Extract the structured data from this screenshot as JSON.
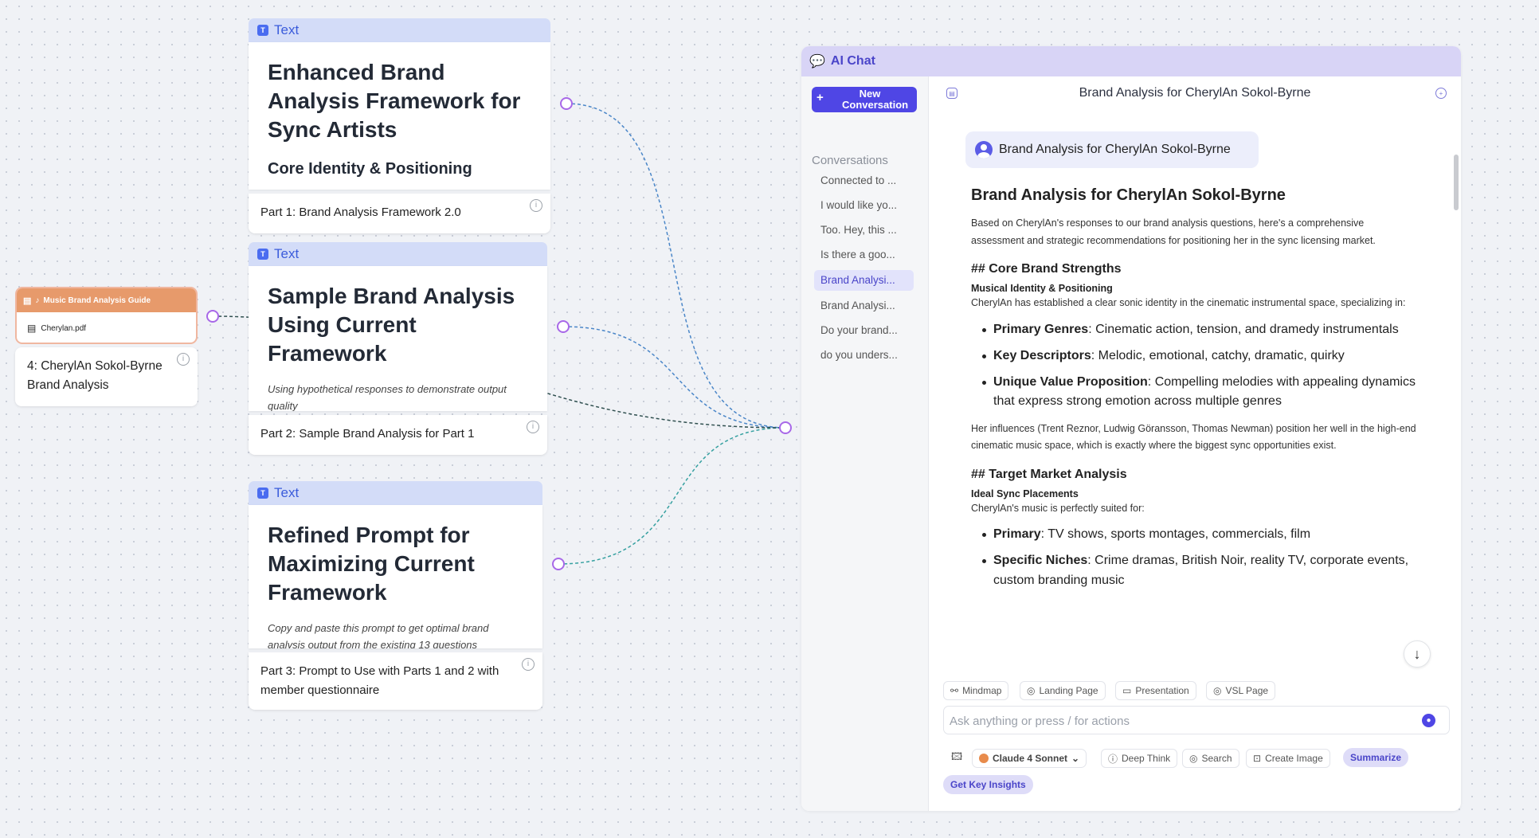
{
  "canvas": {
    "cards": [
      {
        "header": "Text",
        "title_lines": [
          "Enhanced Brand",
          "Analysis Framework for",
          "Sync Artists"
        ],
        "subtitle": "Core Identity & Positioning",
        "footer": "Part 1: Brand Analysis Framework 2.0"
      },
      {
        "header": "Text",
        "title_lines": [
          "Sample Brand Analysis",
          "Using Current",
          "Framework"
        ],
        "italic": "Using hypothetical responses to demonstrate output quality",
        "footer": "Part 2: Sample Brand Analysis for Part 1"
      },
      {
        "header": "Text",
        "title_lines": [
          "Refined Prompt for",
          "Maximizing Current",
          "Framework"
        ],
        "italic": "Copy and paste this prompt to get optimal brand analysis output from the existing 13 questions",
        "footer": "Part 3: Prompt to Use with Parts 1 and 2 with member questionnaire"
      }
    ],
    "file_node": {
      "header": "Music Brand Analysis Guide",
      "file_name": "Cherylan.pdf",
      "footer": "4: CherylAn Sokol-Byrne Brand Analysis"
    }
  },
  "chat": {
    "panel_title": "AI Chat",
    "new_conversation_label": "New Conversation",
    "conversations_title": "Conversations",
    "conversations": [
      "Connected to ...",
      "I would like yo...",
      "Too. Hey, this ...",
      "Is there a goo...",
      "Brand Analysi...",
      "Brand Analysi...",
      "Do your brand...",
      "do you unders..."
    ],
    "active_conversation_index": 4,
    "header_title": "Brand Analysis for CherylAn Sokol-Byrne",
    "user_message": "Brand Analysis for CherylAn Sokol-Byrne",
    "answer": {
      "h1": "Brand Analysis for CherylAn Sokol-Byrne",
      "intro": "Based on CherylAn's responses to our brand analysis questions, here's a comprehensive assessment and strategic recommendations for positioning her in the sync licensing market.",
      "section1_title": "## Core Brand Strengths",
      "section1_sub": "Musical Identity & Positioning",
      "section1_text": "CherylAn has established a clear sonic identity in the cinematic instrumental space, specializing in:",
      "bullets1": [
        {
          "label": "Primary Genres",
          "text": ": Cinematic action, tension, and dramedy instrumentals"
        },
        {
          "label": "Key Descriptors",
          "text": ": Melodic, emotional, catchy, dramatic, quirky"
        },
        {
          "label": "Unique Value Proposition",
          "text": ": Compelling melodies with appealing dynamics that express strong emotion across multiple genres"
        }
      ],
      "influences": "Her influences (Trent Reznor, Ludwig Göransson, Thomas Newman) position her well in the high-end cinematic music space, which is exactly where the biggest sync opportunities exist.",
      "section2_title": "## Target Market Analysis",
      "section2_sub": "Ideal Sync Placements",
      "section2_text": "CherylAn's music is perfectly suited for:",
      "bullets2": [
        {
          "label": "Primary",
          "text": ": TV shows, sports montages, commercials, film"
        },
        {
          "label": "Specific Niches",
          "text": ": Crime dramas, British Noir, reality TV, corporate events, custom branding music"
        }
      ]
    },
    "quick_actions": [
      "Mindmap",
      "Landing Page",
      "Presentation",
      "VSL Page"
    ],
    "input_placeholder": "Ask anything or press / for actions",
    "model_label": "Claude 4 Sonnet",
    "tools": [
      "Deep Think",
      "Search",
      "Create Image",
      "Summarize",
      "Get Key Insights"
    ],
    "accent_color": "#4f46e5"
  }
}
